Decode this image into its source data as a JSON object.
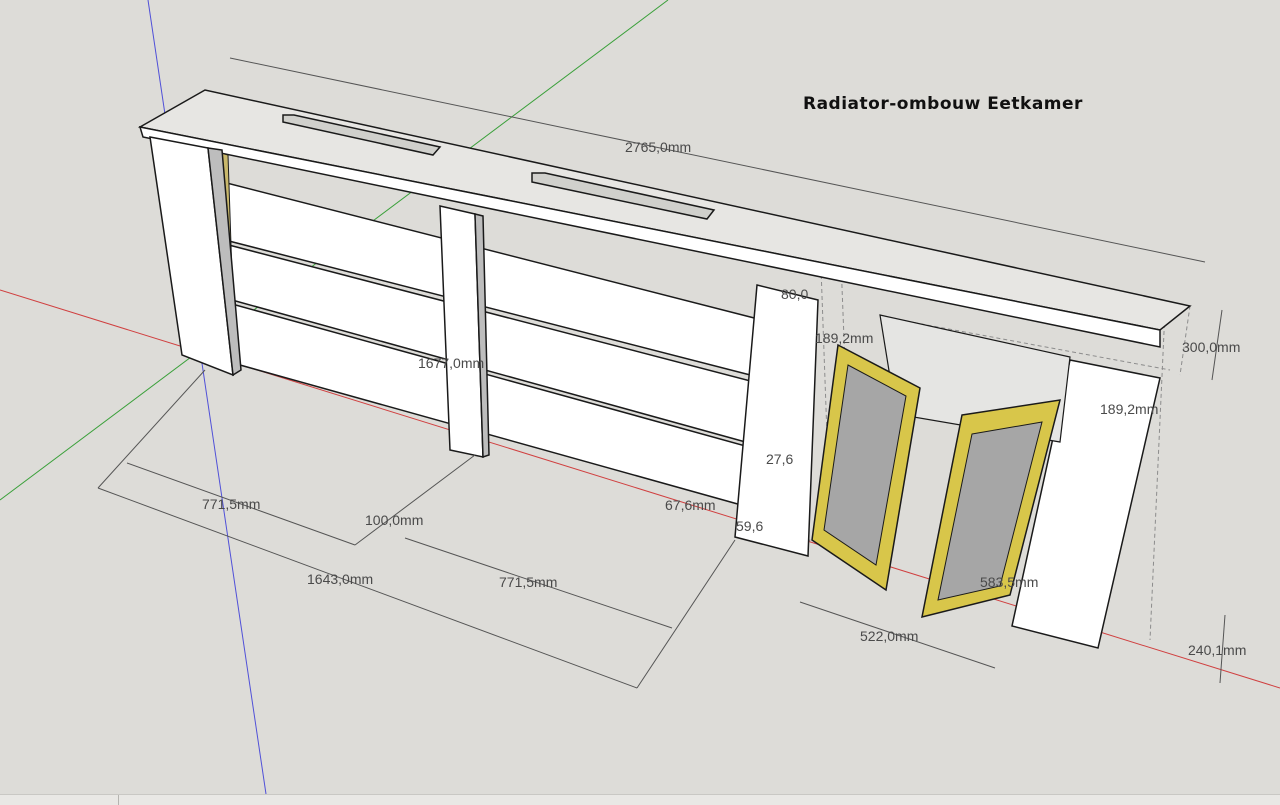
{
  "title": "Radiator-ombouw Eetkamer",
  "colors": {
    "background": "#dddcd8",
    "panel": "#ffffff",
    "edge": "#1a1a1a",
    "hidden_line": "#8c8c8c",
    "door_frame": "#d8c64a",
    "door_glass": "#a6a6a6",
    "axis_red": "#d04040",
    "axis_green": "#3aa03a",
    "axis_blue": "#5050d8"
  },
  "dimensions": {
    "overall_length": "2765,0mm",
    "height": "300,0mm",
    "depth": "240,1mm",
    "bay_1": "771,5mm",
    "bay_2": "771,5mm",
    "post_width": "100,0mm",
    "span_total": "1643,0mm",
    "rail_length": "1677,0mm",
    "door_width": "522,0mm",
    "door_height": "583,5mm",
    "inner_height_a": "189,2mm",
    "inner_height_b": "189,2mm",
    "gap_top": "80,0",
    "gap_mid": "27,6",
    "gap_low": "59,6",
    "offset": "67,6mm"
  }
}
